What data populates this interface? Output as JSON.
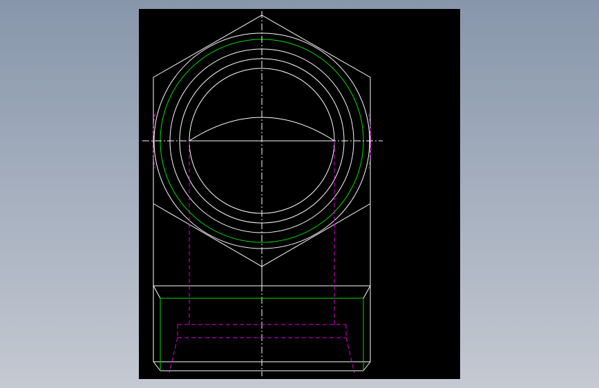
{
  "viewer": {
    "canvas_color": "#000000",
    "background_top": "#8796ab",
    "background_bottom": "#c4c9d2"
  },
  "drawing": {
    "layers": [
      {
        "name": "outline",
        "color": "#ffffff",
        "linetype": "continuous"
      },
      {
        "name": "thread",
        "color": "#00e000",
        "linetype": "continuous"
      },
      {
        "name": "hidden",
        "color": "#e000e0",
        "linetype": "dashed"
      },
      {
        "name": "center",
        "color": "#ffffff",
        "linetype": "dash-dot"
      }
    ],
    "top_view": "hex-nut-circles",
    "front_view": "nut-section-with-hidden-bore"
  }
}
